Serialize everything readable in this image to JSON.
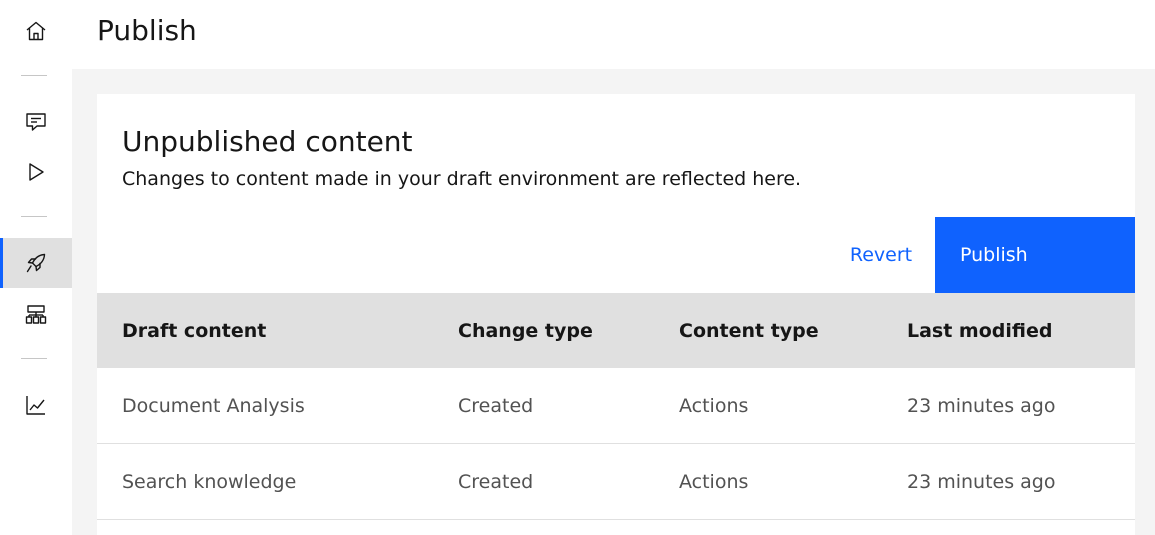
{
  "page": {
    "title": "Publish"
  },
  "nav": {
    "items": [
      {
        "name": "home",
        "icon": "home-icon"
      },
      {
        "name": "chat",
        "icon": "chat-icon"
      },
      {
        "name": "preview",
        "icon": "play-icon"
      },
      {
        "name": "publish",
        "icon": "rocket-icon",
        "active": true
      },
      {
        "name": "environments",
        "icon": "hierarchy-icon"
      },
      {
        "name": "analytics",
        "icon": "chart-line-icon"
      }
    ]
  },
  "card": {
    "title": "Unpublished content",
    "description": "Changes to content made in your draft environment are reflected here.",
    "revert_label": "Revert",
    "publish_label": "Publish"
  },
  "table": {
    "headers": [
      "Draft content",
      "Change type",
      "Content type",
      "Last modified"
    ],
    "rows": [
      [
        "Document Analysis",
        "Created",
        "Actions",
        "23 minutes ago"
      ],
      [
        "Search knowledge",
        "Created",
        "Actions",
        "23 minutes ago"
      ]
    ]
  },
  "colors": {
    "accent": "#0f62fe",
    "active_nav_bg": "#e0e0e0",
    "table_header_bg": "#e0e0e0",
    "page_bg": "#f4f4f4"
  }
}
